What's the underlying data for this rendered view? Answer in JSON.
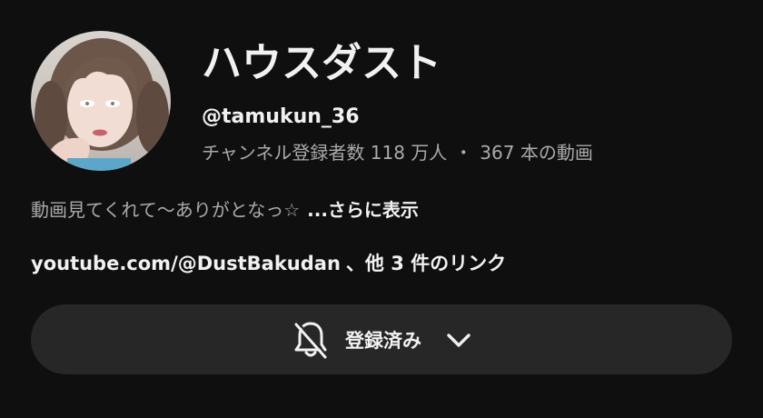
{
  "channel": {
    "name": "ハウスダスト",
    "handle": "@tamukun_36",
    "subscribers": "チャンネル登録者数 118 万人",
    "separator": "・",
    "videos": "367 本の動画"
  },
  "description": {
    "text": "動画見てくれて〜ありがとなっ☆",
    "more_label": "...さらに表示"
  },
  "links": {
    "url": "youtube.com/@DustBakudan",
    "suffix": "、他 3 件のリンク"
  },
  "subscribe_button": {
    "label": "登録済み",
    "icon": "bell-off-icon",
    "dropdown_icon": "chevron-down-icon"
  },
  "colors": {
    "background": "#0f0f0f",
    "button": "#272727",
    "primary_text": "#f1f1f1",
    "secondary_text": "#aaaaaa"
  }
}
